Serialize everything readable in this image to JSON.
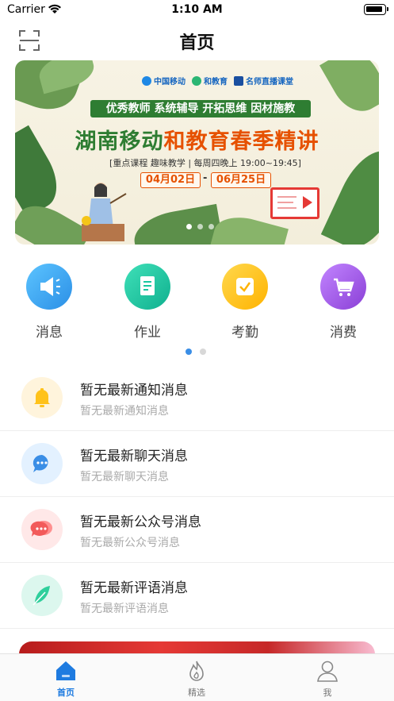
{
  "status_bar": {
    "carrier": "Carrier",
    "time": "1:10 AM"
  },
  "nav": {
    "title": "首页"
  },
  "banner": {
    "brands": [
      "中国移动",
      "和教育",
      "名师直播课堂"
    ],
    "tagline": "优秀教师  系统辅导  开拓思维  因材施教",
    "headline_part1": "湖南移动",
    "headline_part2": "和教育春季精讲",
    "subline": "[重点课程  趣味教学 | 每周四晚上 19:00~19:45]",
    "date_start": "04月02日",
    "date_sep": "-",
    "date_end": "06月25日",
    "slide_count": 3,
    "active_slide": 1
  },
  "quick_menu": [
    {
      "label": "消息",
      "icon": "megaphone-icon",
      "color": "#3aa7f0"
    },
    {
      "label": "作业",
      "icon": "document-icon",
      "color": "#18c7a0"
    },
    {
      "label": "考勤",
      "icon": "checkbox-icon",
      "color": "#ffc21a"
    },
    {
      "label": "消费",
      "icon": "cart-icon",
      "color": "#a45be6"
    }
  ],
  "quick_menu_pages": {
    "count": 2,
    "active": 1
  },
  "messages": [
    {
      "title": "暂无最新通知消息",
      "subtitle": "暂无最新通知消息",
      "icon": "bell-icon"
    },
    {
      "title": "暂无最新聊天消息",
      "subtitle": "暂无最新聊天消息",
      "icon": "chat-bubble-icon"
    },
    {
      "title": "暂无最新公众号消息",
      "subtitle": "暂无最新公众号消息",
      "icon": "official-account-icon"
    },
    {
      "title": "暂无最新评语消息",
      "subtitle": "暂无最新评语消息",
      "icon": "feather-icon"
    }
  ],
  "tabs": [
    {
      "label": "首页",
      "icon": "home-icon",
      "active": true
    },
    {
      "label": "精选",
      "icon": "flame-icon",
      "active": false
    },
    {
      "label": "我",
      "icon": "person-icon",
      "active": false
    }
  ],
  "colors": {
    "accent": "#1e7be0",
    "brand_green": "#2e7d32",
    "brand_orange": "#e65100"
  }
}
